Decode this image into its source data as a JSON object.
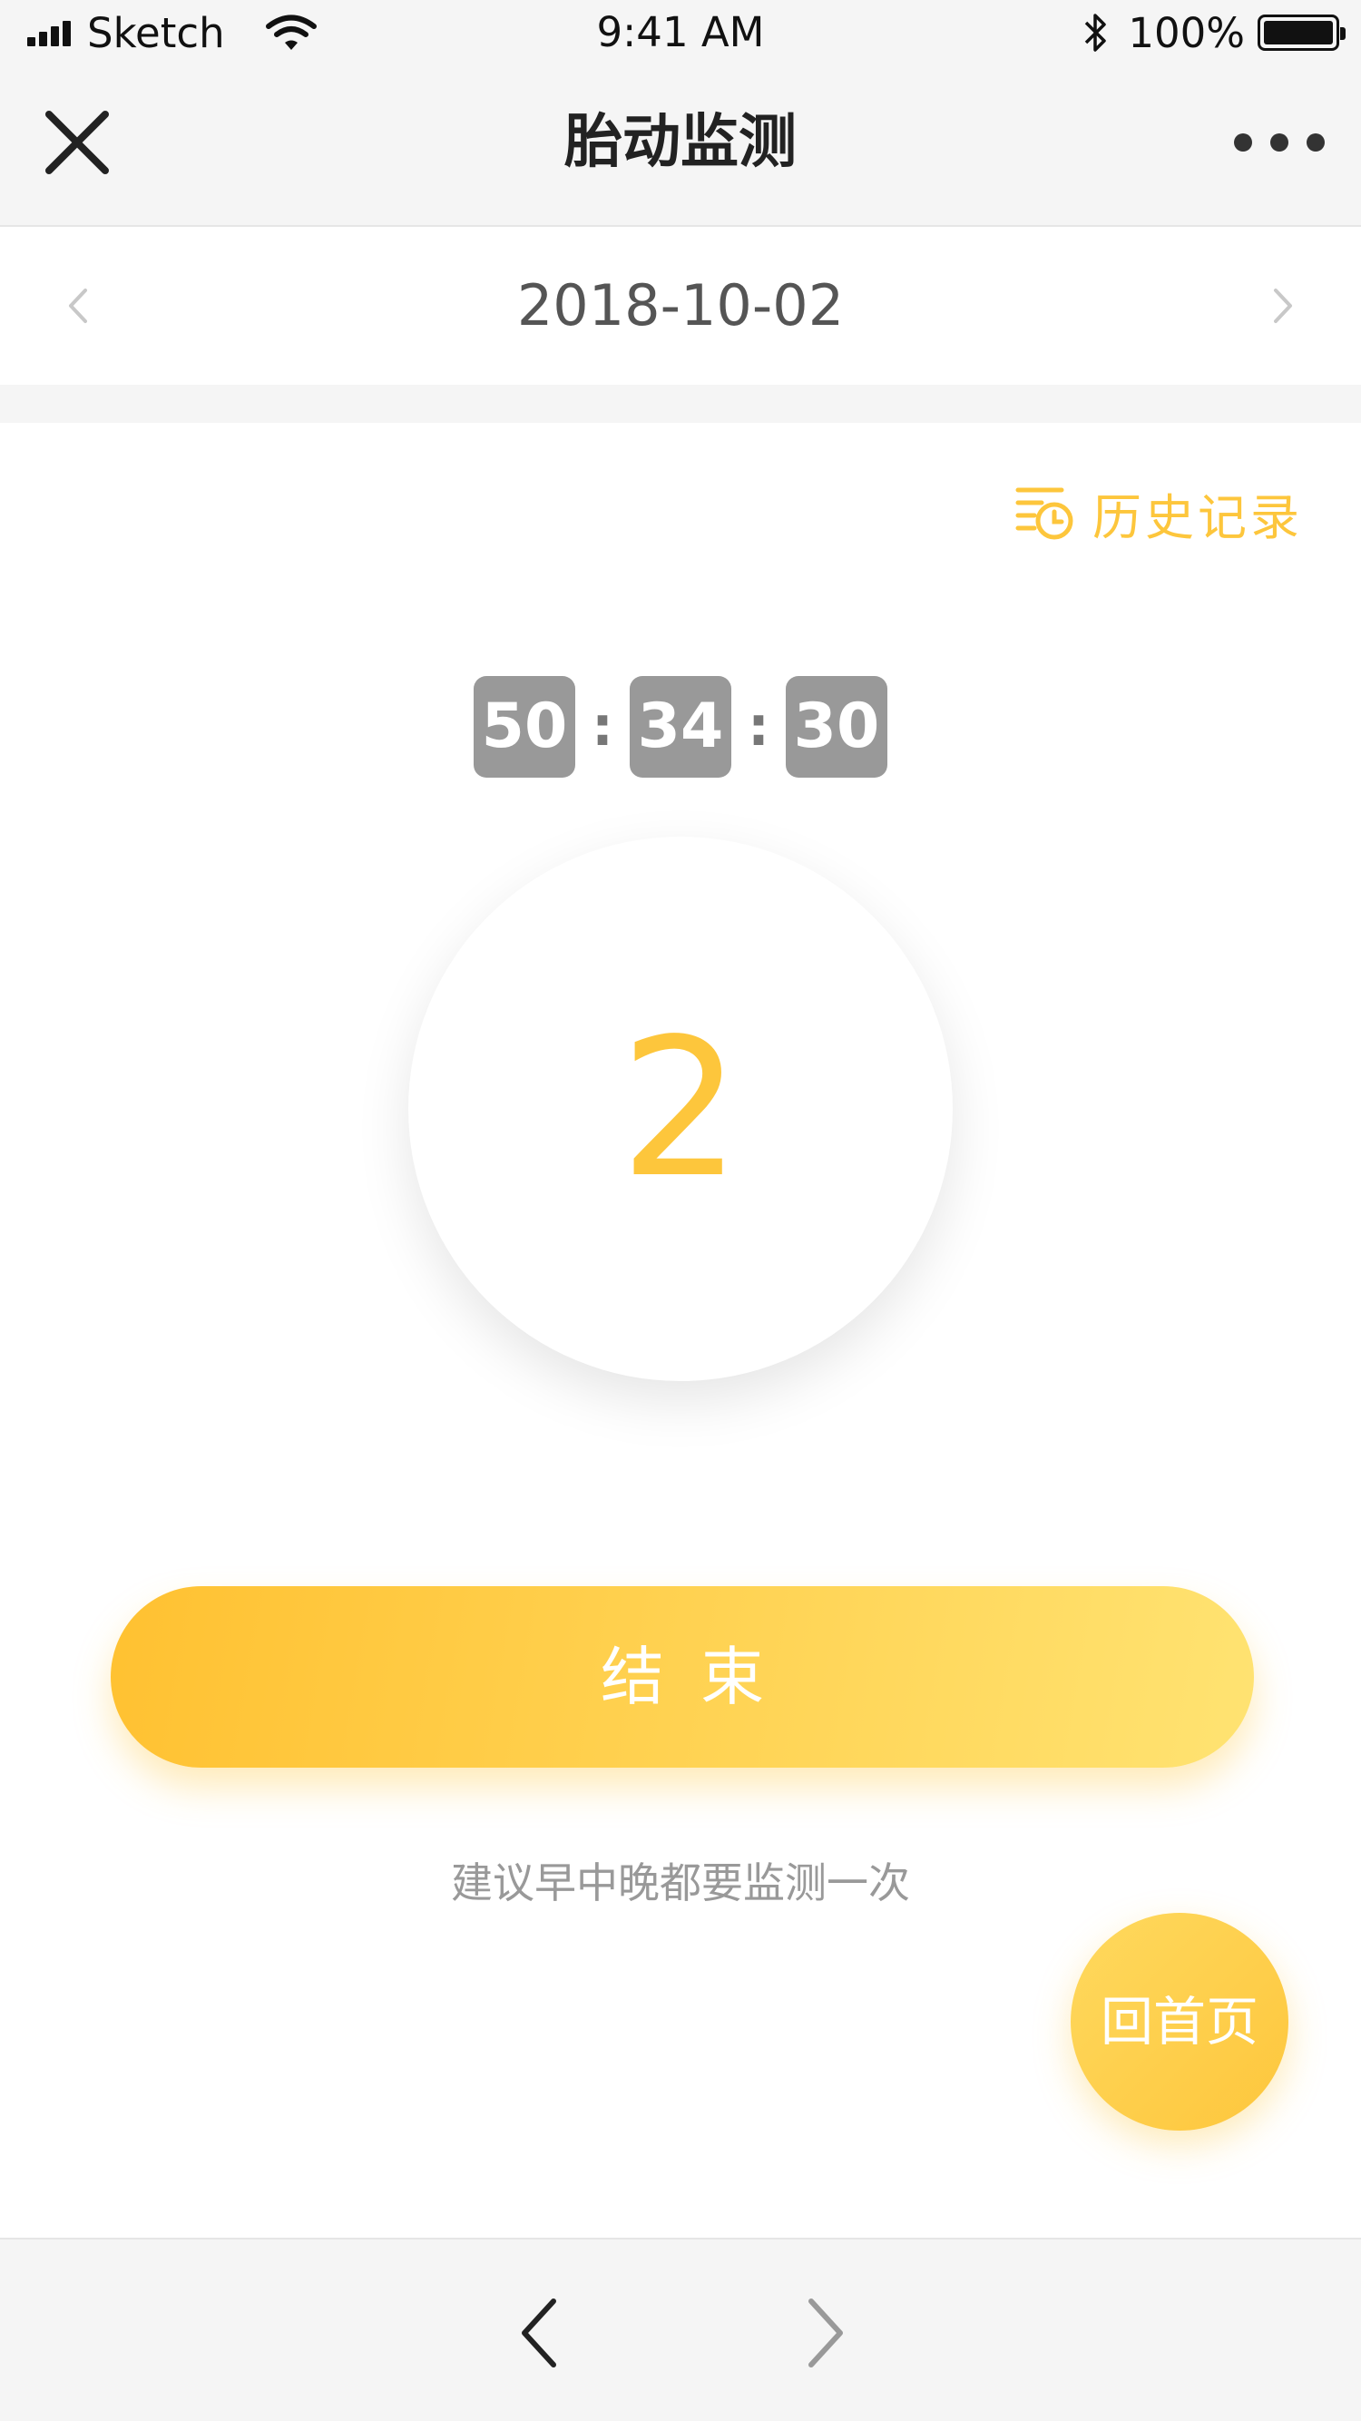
{
  "status_bar": {
    "carrier": "Sketch",
    "time": "9:41 AM",
    "battery": "100%"
  },
  "nav": {
    "title": "胎动监测"
  },
  "date_bar": {
    "date": "2018-10-02"
  },
  "history": {
    "label": "历史记录"
  },
  "timer": {
    "minutes": "50",
    "seconds": "34",
    "hundredths": "30",
    "separator": ":"
  },
  "counter": {
    "value": "2"
  },
  "actions": {
    "end_label": "结束",
    "hint": "建议早中晚都要监测一次",
    "home_label": "回首页"
  },
  "colors": {
    "accent": "#fdc63c",
    "timer_box": "#999999"
  },
  "icons": {
    "close": "close-icon",
    "more": "more-icon",
    "prev": "chevron-left-icon",
    "next": "chevron-right-icon",
    "history": "history-clock-icon",
    "back": "back-arrow-icon",
    "forward": "forward-arrow-icon"
  }
}
